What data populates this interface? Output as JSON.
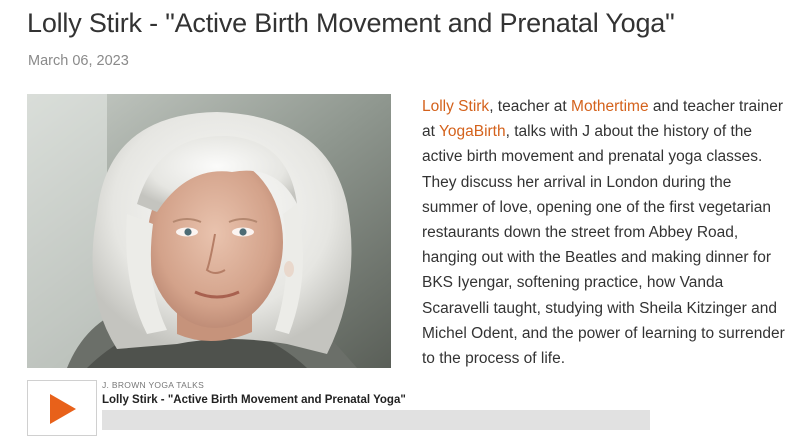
{
  "post": {
    "title": "Lolly Stirk - \"Active Birth Movement and Prenatal Yoga\"",
    "date": "March 06, 2023",
    "photo_alt": "Portrait of Lolly Stirk",
    "body": {
      "link_lolly": "Lolly Stirk",
      "text_1": ", teacher at ",
      "link_mothertime": "Mothertime",
      "text_2": " and teacher trainer at ",
      "link_yogabirth": "YogaBirth",
      "text_3": ", talks with J about the history of the active birth movement and prenatal yoga classes. They discuss her arrival in London during the summer of love, opening one of the first vegetarian restaurants down the street from Abbey Road, hanging out with the Beatles and making dinner for BKS Iyengar, softening practice, how Vanda Scaravelli taught, studying with Sheila Kitzinger and Michel Odent, and the power of learning to surrender to the process of life."
    }
  },
  "player": {
    "show_name": "J. BROWN YOGA TALKS",
    "episode_title": "Lolly Stirk - \"Active Birth Movement and Prenatal Yoga\"",
    "play_icon": "play-icon",
    "progress": 0
  },
  "colors": {
    "link": "#d4621c",
    "play": "#e8611a",
    "progress_track": "#e1e1e1"
  }
}
